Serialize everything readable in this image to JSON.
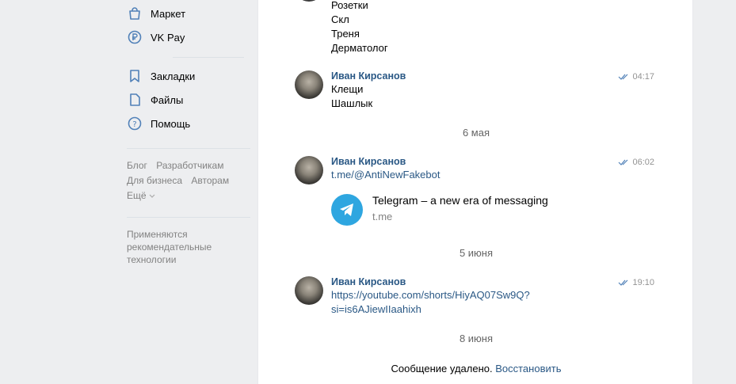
{
  "sidebar": {
    "items": [
      {
        "label": "Маркет",
        "icon": "bag-icon"
      },
      {
        "label": "VK Pay",
        "icon": "ruble-circle-icon"
      },
      {
        "label": "Закладки",
        "icon": "bookmark-icon"
      },
      {
        "label": "Файлы",
        "icon": "file-icon"
      },
      {
        "label": "Помощь",
        "icon": "help-icon"
      }
    ],
    "footer": {
      "blog": "Блог",
      "developers": "Разработчикам",
      "business": "Для бизнеса",
      "authors": "Авторам",
      "more": "Ещё"
    },
    "note": "Применяются рекомендательные технологии"
  },
  "chat": {
    "top_lines": [
      "Розетки",
      "Скл",
      "Треня",
      "Дерматолог"
    ],
    "messages": [
      {
        "author": "Иван Кирсанов",
        "time": "04:17",
        "lines": [
          "Клещи",
          "Шашлык"
        ]
      },
      {
        "author": "Иван Кирсанов",
        "time": "06:02",
        "link": "t.me/@AntiNewFakebot",
        "preview": {
          "title": "Telegram – a new era of messaging",
          "domain": "t.me"
        }
      },
      {
        "author": "Иван Кирсанов",
        "time": "19:10",
        "link_lines": [
          "https://youtube.com/shorts/HiyAQ07Sw9Q?",
          "si=is6AJiewIIaahixh"
        ]
      }
    ],
    "dates": [
      "6 мая",
      "5 июня",
      "8 июня"
    ],
    "deleted": {
      "text": "Сообщение удалено.",
      "restore": "Восстановить"
    }
  },
  "colors": {
    "link": "#2a5885",
    "muted": "#828282",
    "telegram": "#2ea6e0",
    "background": "#edeef0"
  }
}
